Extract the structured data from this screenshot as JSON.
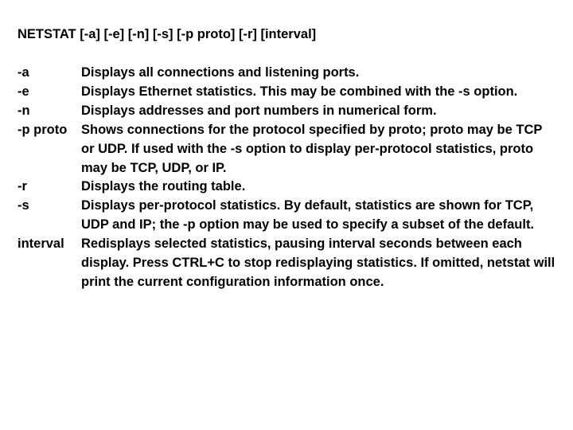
{
  "usage": "NETSTAT [-a] [-e] [-n] [-s] [-p proto] [-r] [interval]",
  "opts": [
    {
      "flag": "-a",
      "desc": " Displays all connections and listening ports."
    },
    {
      "flag": "-e",
      "desc": " Displays Ethernet statistics. This may be combined with the -s option."
    },
    {
      "flag": "-n",
      "desc": " Displays addresses and port numbers in numerical form."
    },
    {
      "flag": "-p proto",
      "desc": "   Shows connections for the protocol specified by proto; proto may be TCP or UDP.  If used with the -s option to display per-protocol statistics, proto may be TCP, UDP, or IP."
    },
    {
      "flag": "-r",
      "desc": " Displays the routing table."
    },
    {
      "flag": "-s",
      "desc": " Displays per-protocol statistics.  By default, statistics are shown for TCP, UDP and IP;  the -p option may be used to specify a subset of the default."
    },
    {
      "flag": "interval",
      "desc": "    Redisplays selected statistics, pausing interval seconds between each display.  Press CTRL+C to stop redisplaying statistics.  If omitted, netstat will print the current configuration information once."
    }
  ]
}
